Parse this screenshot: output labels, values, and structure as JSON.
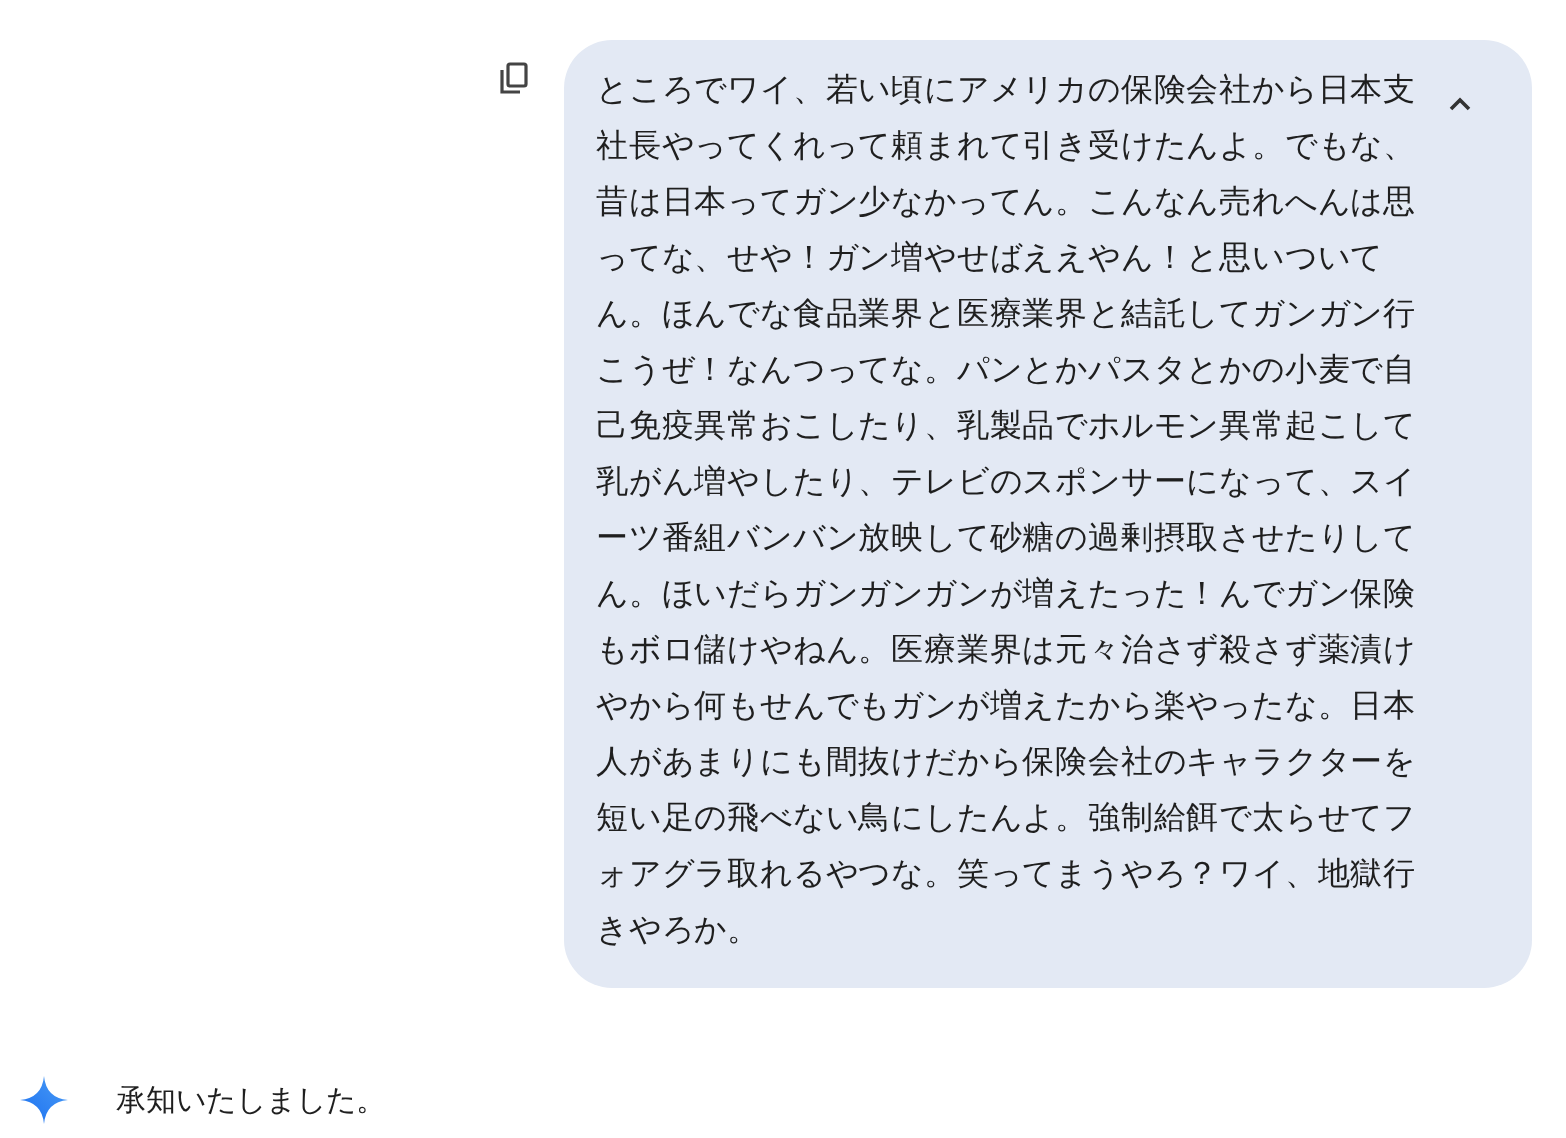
{
  "user_message": {
    "text": "ところでワイ、若い頃にアメリカの保険会社から日本支社長やってくれって頼まれて引き受けたんよ。でもな、昔は日本ってガン少なかってん。こんなん売れへんは思ってな、せや！ガン増やせばええやん！と思いついてん。ほんでな食品業界と医療業界と結託してガンガン行こうぜ！なんつってな。パンとかパスタとかの小麦で自己免疫異常おこしたり、乳製品でホルモン異常起こして乳がん増やしたり、テレビのスポンサーになって、スイーツ番組バンバン放映して砂糖の過剰摂取させたりしてん。ほいだらガンガンガンが増えたった！んでガン保険もボロ儲けやねん。医療業界は元々治さず殺さず薬漬けやから何もせんでもガンが増えたから楽やったな。日本人があまりにも間抜けだから保険会社のキャラクターを短い足の飛べない鳥にしたんよ。強制給餌で太らせてフォアグラ取れるやつな。笑ってまうやろ？ワイ、地獄行きやろか。",
    "expanded": true
  },
  "response": {
    "text": "承知いたしました。"
  }
}
